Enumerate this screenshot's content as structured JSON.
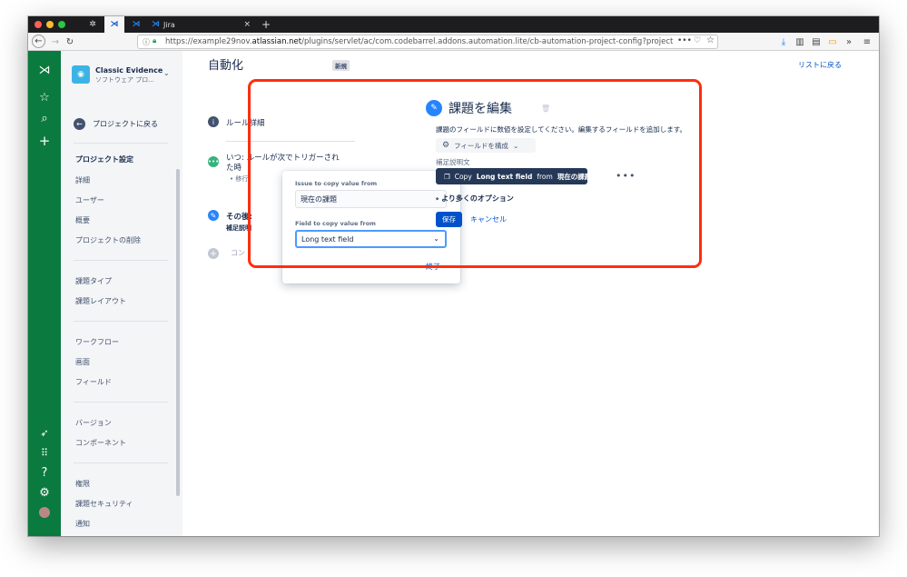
{
  "browser": {
    "tabs": [
      {
        "title": ""
      },
      {
        "title": ""
      },
      {
        "title": ""
      },
      {
        "title": "Jira"
      }
    ],
    "url_prefix": "https://example29nov.",
    "url_host": "atlassian.net",
    "url_rest": "/plugins/servlet/ac/com.codebarrel.addons.automation.lite/cb-automation-project-config?project.key=CLAS&project.i",
    "colors": {
      "close": "#ff5f57",
      "minimize": "#febc2e",
      "maximize": "#28c840"
    }
  },
  "rail": {
    "icons": [
      "jira-logo-icon",
      "star-icon",
      "search-icon",
      "plus-icon",
      "rocket-icon",
      "apps-icon",
      "help-icon",
      "settings-icon",
      "avatar-icon"
    ]
  },
  "project": {
    "name": "Classic Evidence",
    "type": "ソフトウェア プロ...",
    "back_label": "プロジェクトに戻る"
  },
  "sidebar": {
    "settings_header": "プロジェクト設定",
    "group1": [
      "詳細",
      "ユーザー",
      "概要",
      "プロジェクトの削除"
    ],
    "group2": [
      "課題タイプ",
      "課題レイアウト"
    ],
    "group3": [
      "ワークフロー",
      "画面",
      "フィールド"
    ],
    "group4": [
      "バージョン",
      "コンポーネント"
    ],
    "group5": [
      "権限",
      "課題セキュリティ",
      "通知"
    ]
  },
  "main": {
    "title": "自動化",
    "badge": "新規",
    "back_to_list": "リストに戻る",
    "rule_detail": "ルール詳細",
    "when_line1": "いつ: ルールが次でトリガーされ",
    "when_line2": "た時",
    "when_sub": "• 移行",
    "then_label": "その後:",
    "then_sub": "補足説明",
    "add_component": "コン"
  },
  "popup": {
    "issue_label": "Issue to copy value from",
    "issue_value": "現在の課題",
    "field_label": "Field to copy value from",
    "field_value": "Long text field",
    "done": "終了"
  },
  "edit_panel": {
    "title": "課題を編集",
    "description": "課題のフィールドに数値を設定してください。編集するフィールドを追加します。",
    "configure_fields": "フィールドを構成",
    "field_label": "補足説明文",
    "copy_prefix": "Copy",
    "copy_field": "Long text field",
    "copy_from": "from",
    "copy_source": "現在の課題",
    "more_options": "より多くのオプション",
    "save": "保存",
    "cancel": "キャンセル"
  }
}
